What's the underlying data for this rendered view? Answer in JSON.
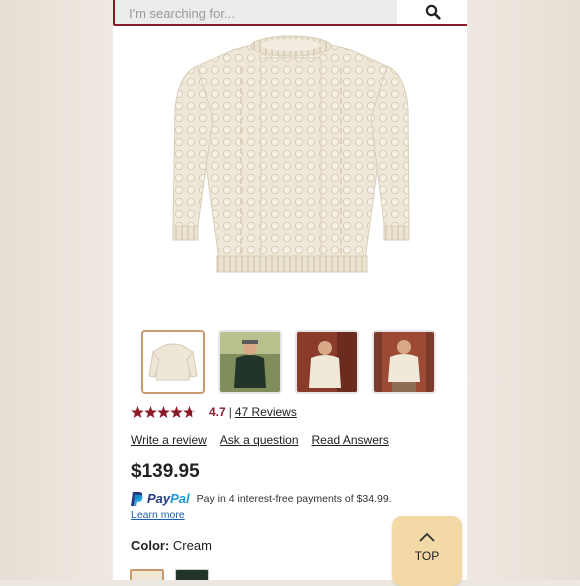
{
  "search": {
    "placeholder": "I'm searching for...",
    "icon": "search-icon"
  },
  "product": {
    "image_alt": "cream cable-knit sweater",
    "thumbnails": [
      {
        "name": "sweater-flat",
        "active": true
      },
      {
        "name": "model-green-sweater",
        "active": false
      },
      {
        "name": "model-cream-sweater-brick",
        "active": false
      },
      {
        "name": "model-cream-sweater-door",
        "active": false
      }
    ],
    "rating": {
      "value": "4.7",
      "separator": "|",
      "reviews_label": "47 Reviews",
      "stars": 4.7
    },
    "actions": {
      "write_review": "Write a review",
      "ask_question": "Ask a question",
      "read_answers": "Read Answers"
    },
    "price": "$139.95",
    "paypal": {
      "brand_part1": "Pay",
      "brand_part2": "Pal",
      "text": "Pay in 4 interest-free payments of $34.99.",
      "learn_more": "Learn more"
    },
    "color": {
      "label": "Color:",
      "value": "Cream"
    }
  },
  "back_to_top": {
    "label": "TOP"
  },
  "colors": {
    "brand": "#8b1a2b",
    "accent": "#c79a6c",
    "top_button": "#f2d9a6"
  }
}
